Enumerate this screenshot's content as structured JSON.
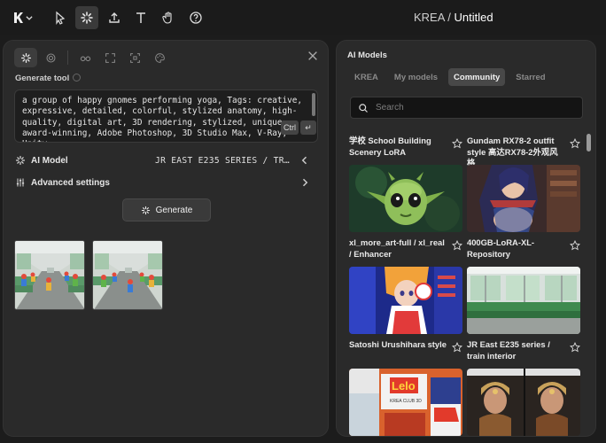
{
  "topbar": {
    "brand": "KREA",
    "separator": " / ",
    "doc_title": "Untitled",
    "tools": [
      "logo-icon",
      "chevron-down-icon",
      "cursor-icon",
      "loader-icon",
      "upload-icon",
      "text-icon",
      "hand-icon",
      "help-icon"
    ]
  },
  "left": {
    "section_label": "Generate tool",
    "prompt": "a group of happy gnomes performing yoga, Tags: creative, expressive, detailed, colorful, stylized anatomy, high-quality, digital art, 3D rendering, stylized, unique, award-winning, Adobe Photoshop, 3D Studio Max, V-Ray, Unity",
    "kbd_ctrl": "Ctrl",
    "kbd_enter": "↵",
    "model_label": "AI Model",
    "model_value": "JR EAST E235 SERIES / TR…",
    "advanced_label": "Advanced settings",
    "generate_label": "Generate"
  },
  "right": {
    "title": "AI Models",
    "tabs": [
      "KREA",
      "My models",
      "Community",
      "Starred"
    ],
    "active_tab": "Community",
    "search_placeholder": "Search",
    "models": [
      {
        "name": "学校 School Building Scenery LoRA"
      },
      {
        "name": "Gundam RX78-2 outfit style 高达RX78-2外观风格"
      },
      {
        "name": "xl_more_art-full / xl_real / Enhancer"
      },
      {
        "name": "400GB-LoRA-XL-Repository"
      },
      {
        "name": "Satoshi Urushihara style"
      },
      {
        "name": "JR East E235 series / train interior"
      }
    ],
    "image_labels": {
      "lego_logo": "Lelo",
      "lego_sub": "KREA CLUB 3D"
    }
  },
  "colors": {
    "background": "#1c1c1c",
    "panel": "#2a2a2a",
    "active_tab": "#484848"
  }
}
